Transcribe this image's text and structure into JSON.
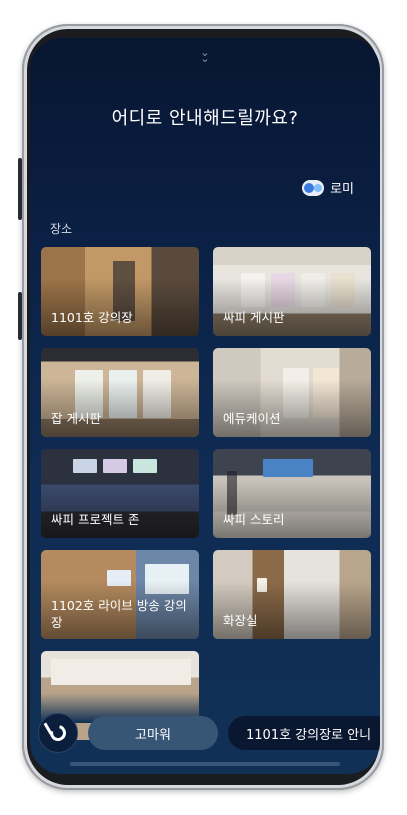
{
  "header": {
    "handle_icon": "chevron-double-down-icon",
    "title": "어디로 안내해드릴까요?"
  },
  "user": {
    "name": "로미",
    "avatar_icon": "avatar-icon"
  },
  "places": {
    "section_label": "장소",
    "items": [
      {
        "label": "1101호 강의장"
      },
      {
        "label": "싸피 게시판"
      },
      {
        "label": "잡 게시판"
      },
      {
        "label": "에듀케이션"
      },
      {
        "label": "싸피 프로젝트 존"
      },
      {
        "label": "싸피 스토리"
      },
      {
        "label": "1102호 라이브 방송 강의장"
      },
      {
        "label": "화장실"
      },
      {
        "label": ""
      }
    ]
  },
  "bottom_bar": {
    "assistant_icon": "bixby-icon",
    "chips": [
      {
        "label": "고마워"
      },
      {
        "label": "1101호 강의장로 안니"
      }
    ]
  },
  "colors": {
    "background_top": "#071631",
    "background_bottom": "#103055",
    "chip_soft": "#375675",
    "chip_dark": "#0a1730"
  }
}
